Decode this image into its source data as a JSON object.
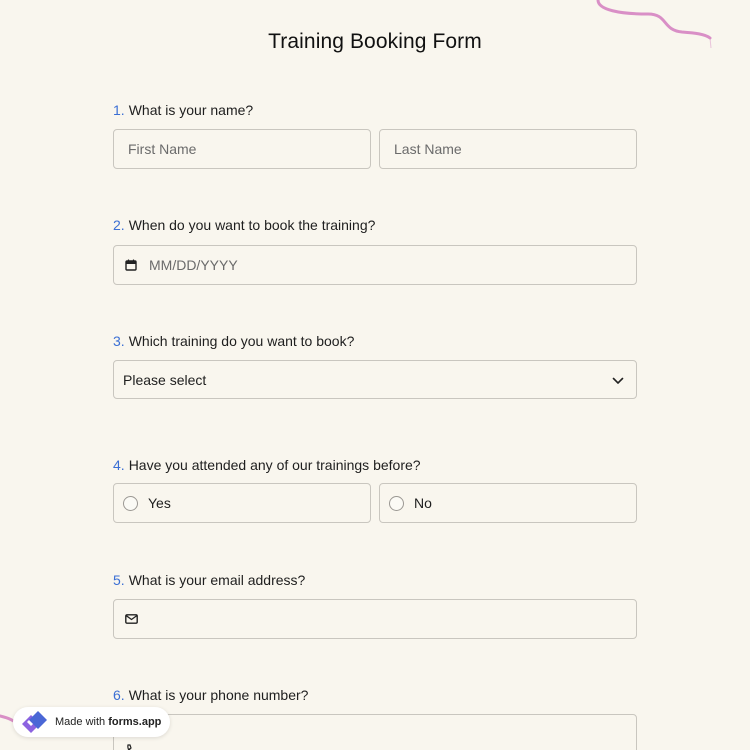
{
  "form": {
    "title": "Training Booking Form"
  },
  "questions": [
    {
      "num": "1.",
      "label": "What is your name?",
      "fields": [
        {
          "placeholder": "First Name"
        },
        {
          "placeholder": "Last Name"
        }
      ]
    },
    {
      "num": "2.",
      "label": "When do you want to book the training?",
      "placeholder": "MM/DD/YYYY",
      "icon": "calendar-icon"
    },
    {
      "num": "3.",
      "label": "Which training do you want to book?",
      "selected": "Please select",
      "icon": "chevron-down-icon"
    },
    {
      "num": "4.",
      "label": "Have you attended any of our trainings before?",
      "options": [
        "Yes",
        "No"
      ]
    },
    {
      "num": "5.",
      "label": "What is your email address?",
      "value": "",
      "icon": "mail-icon"
    },
    {
      "num": "6.",
      "label": "What is your phone number?",
      "icon": "phone-icon"
    }
  ],
  "badge": {
    "prefix": "Made with ",
    "brand": "forms.app"
  },
  "colors": {
    "background": "#f9f6ee",
    "accent_number": "#3b6fd4",
    "field_border": "#c9c6bf",
    "decoration": "#d98fc6",
    "logo_blue": "#4a67d6",
    "logo_purple": "#8c63e0"
  }
}
